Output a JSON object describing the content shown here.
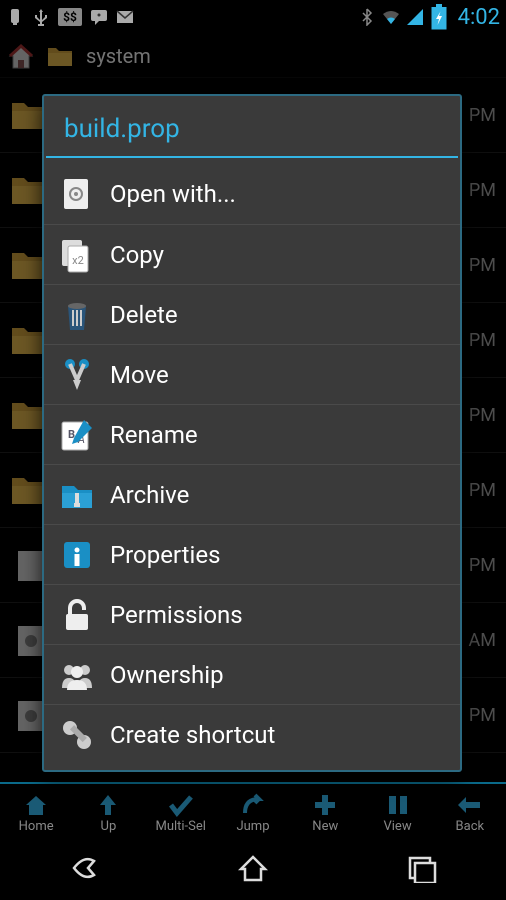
{
  "status": {
    "time": "4:02"
  },
  "path": {
    "current": "system"
  },
  "background_files": [
    {
      "time": "PM"
    },
    {
      "time": "PM"
    },
    {
      "time": "PM"
    },
    {
      "time": "PM"
    },
    {
      "time": "PM"
    },
    {
      "time": "PM"
    },
    {
      "time": "PM"
    },
    {
      "time": "AM"
    },
    {
      "time": "PM"
    }
  ],
  "dialog": {
    "title": "build.prop",
    "items": [
      {
        "icon": "open-with",
        "label": "Open with..."
      },
      {
        "icon": "copy",
        "label": "Copy"
      },
      {
        "icon": "delete",
        "label": "Delete"
      },
      {
        "icon": "move",
        "label": "Move"
      },
      {
        "icon": "rename",
        "label": "Rename"
      },
      {
        "icon": "archive",
        "label": "Archive"
      },
      {
        "icon": "properties",
        "label": "Properties"
      },
      {
        "icon": "permissions",
        "label": "Permissions"
      },
      {
        "icon": "ownership",
        "label": "Ownership"
      },
      {
        "icon": "shortcut",
        "label": "Create shortcut"
      }
    ]
  },
  "toolbar": {
    "items": [
      {
        "label": "Home"
      },
      {
        "label": "Up"
      },
      {
        "label": "Multi-Sel"
      },
      {
        "label": "Jump"
      },
      {
        "label": "New"
      },
      {
        "label": "View"
      },
      {
        "label": "Back"
      }
    ]
  }
}
